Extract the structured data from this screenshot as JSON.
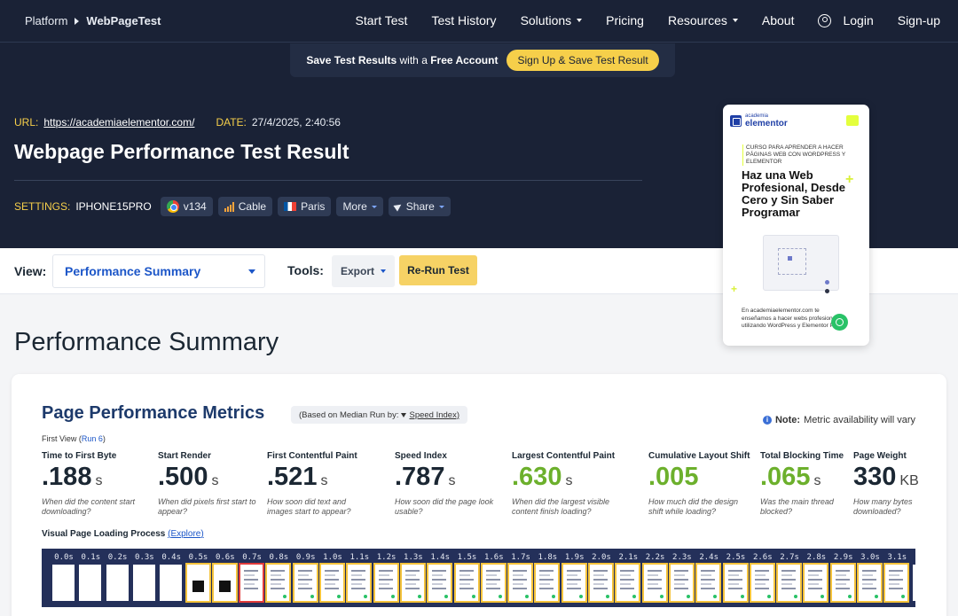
{
  "nav": {
    "breadcrumb_root": "Platform",
    "breadcrumb_site": "WebPageTest",
    "links": [
      "Start Test",
      "Test History",
      "Solutions",
      "Pricing",
      "Resources",
      "About"
    ],
    "login": "Login",
    "signup": "Sign-up"
  },
  "savebar": {
    "text_bold_1": "Save Test Results",
    "text_mid": "with a",
    "text_bold_2": "Free Account",
    "button": "Sign Up & Save Test Result"
  },
  "result": {
    "url_label": "URL:",
    "url": "https://academiaelementor.com/",
    "date_label": "DATE:",
    "date": "27/4/2025, 2:40:56",
    "title": "Webpage Performance Test Result",
    "settings_label": "SETTINGS:",
    "device": "IPHONE15PRO",
    "browser": "v134",
    "connection": "Cable",
    "location": "Paris",
    "more": "More",
    "share": "Share"
  },
  "ad": {
    "brand_small": "academia",
    "brand": "elementor",
    "subtitle": "CURSO PARA APRENDER A HACER PÁGINAS WEB CON WORDPRESS Y ELEMENTOR",
    "headline": "Haz una Web Profesional, Desde Cero y Sin Saber Programar",
    "body": "En academiaelementor.com te enseñamos a hacer webs profesionales utilizando WordPress y Elementor Pro.",
    "accent": "#e4ff3d"
  },
  "toolbar": {
    "view_label": "View:",
    "view_selected": "Performance Summary",
    "tools_label": "Tools:",
    "export": "Export",
    "rerun": "Re-Run Test"
  },
  "page_heading": "Performance Summary",
  "metrics_card": {
    "title": "Page Performance Metrics",
    "median_prefix": "(Based on Median Run by:",
    "median_metric": "Speed Index)",
    "note_bold": "Note:",
    "note_text": "Metric availability will vary",
    "first_view_prefix": "First View (",
    "first_view_run": "Run 6",
    "first_view_suffix": ")",
    "metrics": [
      {
        "name": "Time to First Byte",
        "value": ".188",
        "unit": "s",
        "good": false,
        "desc": "When did the content start downloading?"
      },
      {
        "name": "Start Render",
        "value": ".500",
        "unit": "s",
        "good": false,
        "desc": "When did pixels first start to appear?"
      },
      {
        "name": "First Contentful Paint",
        "value": ".521",
        "unit": "s",
        "good": false,
        "desc": "How soon did text and images start to appear?"
      },
      {
        "name": "Speed Index",
        "value": ".787",
        "unit": "s",
        "good": false,
        "desc": "How soon did the page look usable?"
      },
      {
        "name": "Largest Contentful Paint",
        "value": ".630",
        "unit": "s",
        "good": true,
        "desc": "When did the largest visible content finish loading?"
      },
      {
        "name": "Cumulative Layout Shift",
        "value": ".005",
        "unit": "",
        "good": true,
        "desc": "How much did the design shift while loading?"
      },
      {
        "name": "Total Blocking Time",
        "value": ".065",
        "unit": "s",
        "good": true,
        "desc": "Was the main thread blocked?"
      },
      {
        "name": "Page Weight",
        "value": "330",
        "unit": "KB",
        "good": false,
        "desc": "How many bytes downloaded?"
      }
    ],
    "visual_label": "Visual Page Loading Process",
    "explore_open": "(",
    "explore": "Explore",
    "explore_close": ")",
    "frames": [
      "0.0s",
      "0.1s",
      "0.2s",
      "0.3s",
      "0.4s",
      "0.5s",
      "0.6s",
      "0.7s",
      "0.8s",
      "0.9s",
      "1.0s",
      "1.1s",
      "1.2s",
      "1.3s",
      "1.4s",
      "1.5s",
      "1.6s",
      "1.7s",
      "1.8s",
      "1.9s",
      "2.0s",
      "2.1s",
      "2.2s",
      "2.3s",
      "2.4s",
      "2.5s",
      "2.6s",
      "2.7s",
      "2.8s",
      "2.9s",
      "3.0s",
      "3.1s",
      "3"
    ]
  },
  "colors": {
    "header_bg": "#1a2236",
    "accent_yellow": "#f6cf4a",
    "link_blue": "#1c56c8",
    "good_green": "#6cb02c"
  }
}
